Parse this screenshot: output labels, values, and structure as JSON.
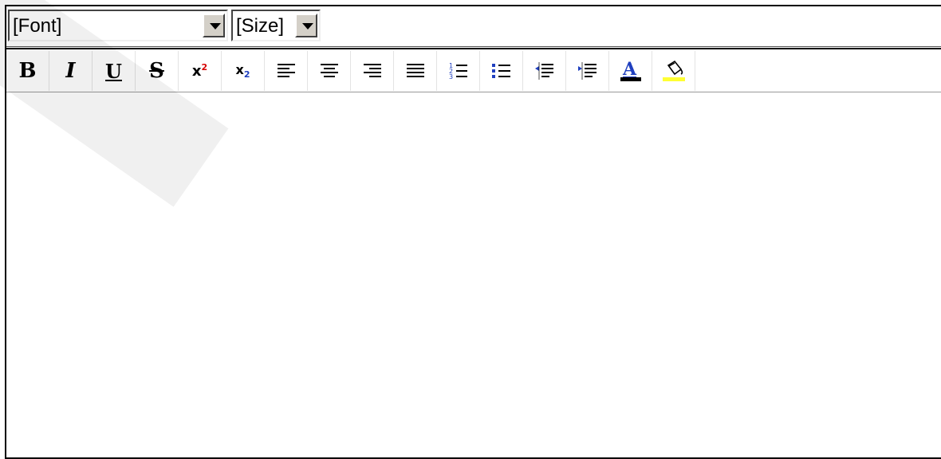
{
  "font_select": {
    "value": "[Font]"
  },
  "size_select": {
    "value": "[Size]"
  },
  "toolbar": {
    "bold": "B",
    "italic": "I",
    "underline": "U",
    "strike": "S",
    "superscript": "x",
    "superscript_mark": "2",
    "subscript": "x",
    "subscript_mark": "2",
    "buttons": [
      {
        "name": "bold-icon"
      },
      {
        "name": "italic-icon"
      },
      {
        "name": "underline-icon"
      },
      {
        "name": "strikethrough-icon"
      },
      {
        "name": "superscript-icon"
      },
      {
        "name": "subscript-icon"
      },
      {
        "name": "align-left-icon"
      },
      {
        "name": "align-center-icon"
      },
      {
        "name": "align-right-icon"
      },
      {
        "name": "align-justify-icon"
      },
      {
        "name": "ordered-list-icon"
      },
      {
        "name": "unordered-list-icon"
      },
      {
        "name": "outdent-icon"
      },
      {
        "name": "indent-icon"
      },
      {
        "name": "font-color-icon"
      },
      {
        "name": "highlight-color-icon"
      }
    ]
  },
  "colors": {
    "font_color_bar": "#000000",
    "highlight_bar": "#ffff33",
    "accent_blue": "#1f3fbf"
  }
}
